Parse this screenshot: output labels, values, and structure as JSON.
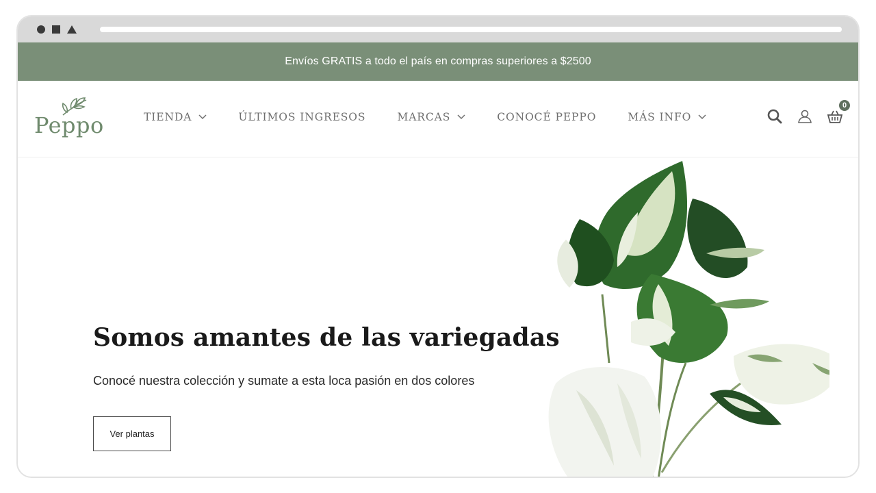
{
  "promo": {
    "text": "Envíos GRATIS a todo el país en compras superiores a $2500"
  },
  "brand": {
    "name": "Peppo",
    "color": "#7a8f78"
  },
  "nav": {
    "items": [
      {
        "label": "TIENDA",
        "has_dropdown": true
      },
      {
        "label": "ÚLTIMOS INGRESOS",
        "has_dropdown": false
      },
      {
        "label": "MARCAS",
        "has_dropdown": true
      },
      {
        "label": "CONOCÉ PEPPO",
        "has_dropdown": false
      },
      {
        "label": "MÁS INFO",
        "has_dropdown": true
      }
    ]
  },
  "header_icons": {
    "search": "search-icon",
    "account": "user-icon",
    "cart": "basket-icon",
    "cart_count": "0"
  },
  "hero": {
    "title": "Somos amantes de las variegadas",
    "subtitle": "Conocé nuestra colección y sumate a esta loca pasión en dos colores",
    "button_label": "Ver plantas"
  }
}
